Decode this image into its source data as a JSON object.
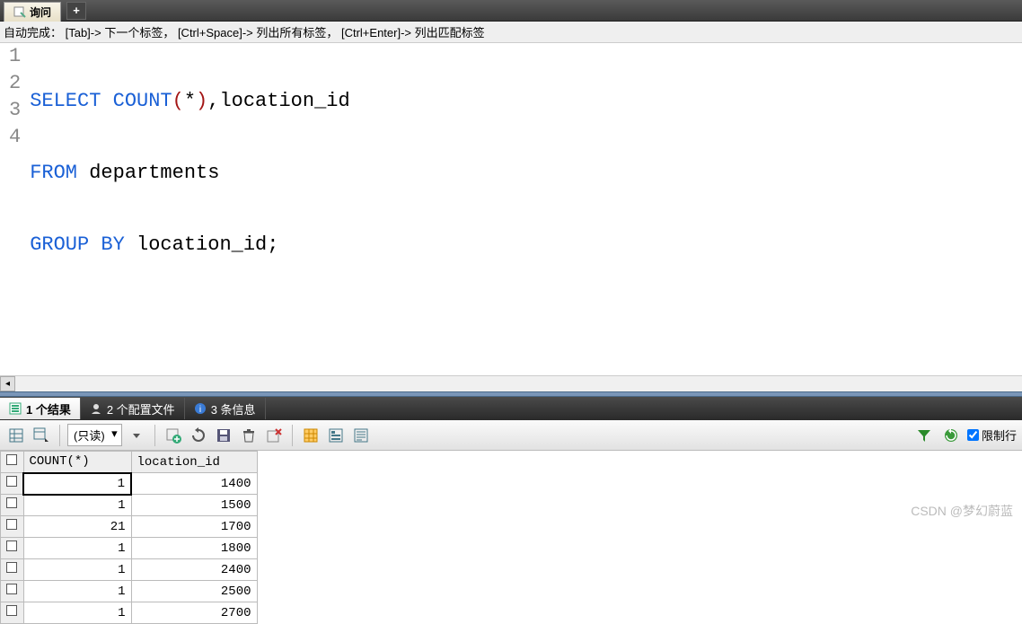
{
  "top_tab": {
    "label": "询问"
  },
  "hint_bar": "自动完成： [Tab]-> 下一个标签， [Ctrl+Space]-> 列出所有标签， [Ctrl+Enter]-> 列出匹配标签",
  "sql": {
    "line_numbers": [
      "1",
      "2",
      "3",
      "4"
    ],
    "l1_select": "SELECT",
    "l1_count": " COUNT",
    "l1_paren_open": "(",
    "l1_star": "*",
    "l1_paren_close": ")",
    "l1_rest": ",location_id",
    "l2_from": "FROM",
    "l2_rest": " departments",
    "l3_group": "GROUP",
    "l3_by": " BY",
    "l3_rest": " location_id;"
  },
  "result_tabs": [
    {
      "label": "1 个结果",
      "active": true
    },
    {
      "label": "2 个配置文件",
      "active": false
    },
    {
      "label": "3 条信息",
      "active": false
    }
  ],
  "toolbar": {
    "readonly_label": "(只读)",
    "limit_label": "限制行",
    "limit_checked": true
  },
  "grid": {
    "headers": [
      "COUNT(*)",
      "location_id"
    ],
    "rows": [
      {
        "count": "1",
        "loc": "1400",
        "selected": true
      },
      {
        "count": "1",
        "loc": "1500"
      },
      {
        "count": "21",
        "loc": "1700"
      },
      {
        "count": "1",
        "loc": "1800"
      },
      {
        "count": "1",
        "loc": "2400"
      },
      {
        "count": "1",
        "loc": "2500"
      },
      {
        "count": "1",
        "loc": "2700"
      }
    ]
  },
  "watermark": "CSDN @梦幻蔚蓝",
  "chart_data": {
    "type": "table",
    "title": "Query Result",
    "columns": [
      "COUNT(*)",
      "location_id"
    ],
    "rows": [
      [
        1,
        1400
      ],
      [
        1,
        1500
      ],
      [
        21,
        1700
      ],
      [
        1,
        1800
      ],
      [
        1,
        2400
      ],
      [
        1,
        2500
      ],
      [
        1,
        2700
      ]
    ]
  }
}
